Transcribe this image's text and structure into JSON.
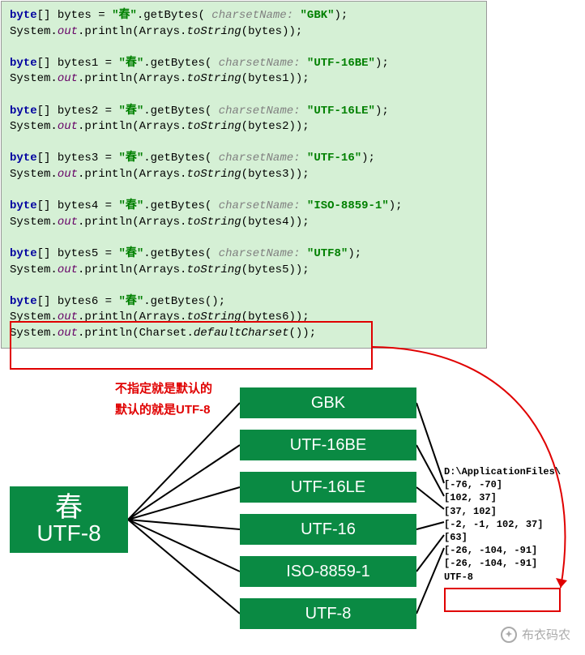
{
  "code": {
    "kw_byte": "byte",
    "brackets": "[] ",
    "vars": [
      "bytes",
      "bytes1",
      "bytes2",
      "bytes3",
      "bytes4",
      "bytes5",
      "bytes6"
    ],
    "eq": " = ",
    "lit": "\"春\"",
    "getBytes_open": ".getBytes( ",
    "getBytes_open_noarg": ".getBytes();",
    "hint": "charsetName: ",
    "charsets": [
      "\"GBK\"",
      "\"UTF-16BE\"",
      "\"UTF-16LE\"",
      "\"UTF-16\"",
      "\"ISO-8859-1\"",
      "\"UTF8\""
    ],
    "close": ");",
    "sys": "System.",
    "out": "out",
    "println": ".println(Arrays.",
    "toString": "toString",
    "postToString_open": "(",
    "postToString_close": "));",
    "defaultCharset_line_a": ".println(Charset.",
    "defaultCharset_m": "defaultCharset",
    "defaultCharset_line_b": "());"
  },
  "anno": {
    "l1": "不指定就是默认的",
    "l2": "默认的就是UTF-8"
  },
  "source_node": {
    "char": "春",
    "encoding": "UTF-8"
  },
  "enc_nodes": [
    "GBK",
    "UTF-16BE",
    "UTF-16LE",
    "UTF-16",
    "ISO-8859-1",
    "UTF-8"
  ],
  "outputs": {
    "header": "D:\\ApplicationFiles\\",
    "lines": [
      "[-76, -70]",
      "[102, 37]",
      "[37, 102]",
      "[-2, -1, 102, 37]",
      "[63]",
      "[-26, -104, -91]",
      "[-26, -104, -91]",
      "UTF-8"
    ]
  },
  "watermark": "布衣码农",
  "chart_data": {
    "type": "diagram",
    "title": "Java String.getBytes() with various charsets",
    "source": {
      "char": "春",
      "default_encoding": "UTF-8"
    },
    "encodings": [
      {
        "name": "GBK",
        "bytes": [
          -76,
          -70
        ]
      },
      {
        "name": "UTF-16BE",
        "bytes": [
          102,
          37
        ]
      },
      {
        "name": "UTF-16LE",
        "bytes": [
          37,
          102
        ]
      },
      {
        "name": "UTF-16",
        "bytes": [
          -2,
          -1,
          102,
          37
        ]
      },
      {
        "name": "ISO-8859-1",
        "bytes": [
          63
        ]
      },
      {
        "name": "UTF8",
        "bytes": [
          -26,
          -104,
          -91
        ]
      },
      {
        "name": "default (UTF-8)",
        "bytes": [
          -26,
          -104,
          -91
        ]
      }
    ],
    "annotation": "不指定就是默认的 / 默认的就是UTF-8 (If unspecified it's the default; the default is UTF-8)"
  }
}
